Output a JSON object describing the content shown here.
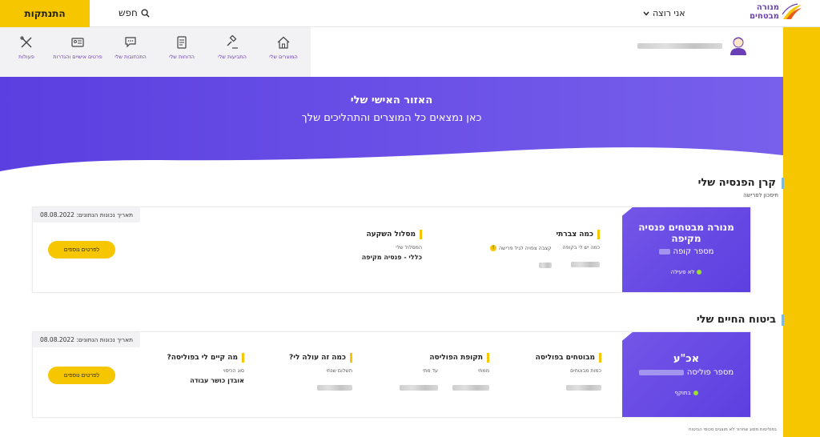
{
  "topbar": {
    "logout": "התנתקות",
    "search": "חפש",
    "iam": "אני רוצה",
    "logo_line1": "מנורה",
    "logo_line2": "מבטחים"
  },
  "nav": [
    {
      "label": "המוצרים שלי",
      "icon": "home-icon"
    },
    {
      "label": "התביעות שלי",
      "icon": "gavel-icon"
    },
    {
      "label": "הדוחות שלי",
      "icon": "document-icon"
    },
    {
      "label": "התכתובות שלי",
      "icon": "chat-icon"
    },
    {
      "label": "פרטים אישיים והגדרות",
      "icon": "id-card-icon"
    },
    {
      "label": "פעולות",
      "icon": "tools-icon"
    }
  ],
  "hero": {
    "title": "האזור האישי שלי",
    "subtitle": "כאן נמצאים כל המוצרים והתהליכים שלך"
  },
  "pension": {
    "section_title": "קרן הפנסיה שלי",
    "section_sub": "חיסכון לפרישה",
    "fund_name": "מנורה מבטחים פנסיה מקיפה",
    "fund_number_label": "מספר קופה",
    "status": "לא פעילה",
    "date_label": "תאריך נכונות הנתונים: 08.08.2022",
    "col1_title": "כמה צברתי",
    "col1_label1": "כמה יש לי בקופה",
    "col1_label2": "קצבה צפויה לגיל פרישה",
    "col2_title": "מסלול השקעה",
    "col2_label": "המסלול שלי",
    "col2_value": "כללי - פנסיה מקיפה",
    "button": "לפרטים נוספים"
  },
  "life": {
    "section_title": "ביטוח החיים שלי",
    "policy_name": "אכ\"ע",
    "policy_number_label": "מספר פוליסה",
    "status": "בתוקף",
    "date_label": "תאריך נכונות הנתונים: 08.08.2022",
    "col1_title": "מבוטחים בפוליסה",
    "col1_label": "כמות מבוטחים",
    "col2_title": "תקופת הפוליסה",
    "col2_label_from": "ממתי",
    "col2_label_to": "עד מתי",
    "col3_title": "כמה זה עולה לי?",
    "col3_label": "תשלום שנתי",
    "col4_title": "מה קיים לי בפוליסה?",
    "col4_label": "סוג הכיסוי",
    "col4_value": "אובדן כושר עבודה",
    "button": "לפרטים נוספים",
    "footnote": "בפוליסות מסוג שחרור לא מוצגים סכומי הביטוח"
  },
  "colors": {
    "brand_purple": "#6a3fb5",
    "accent_yellow": "#f6c700",
    "hero_purple": "#6b4ce6"
  }
}
